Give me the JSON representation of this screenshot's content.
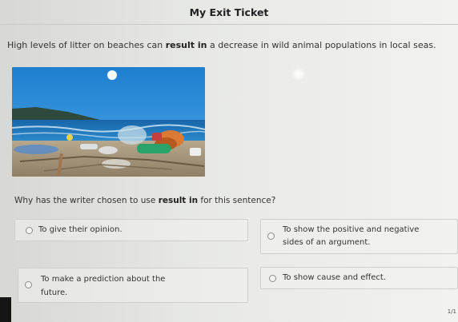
{
  "header": {
    "title": "My Exit Ticket"
  },
  "prompt": {
    "statement_before": "High levels of litter on beaches can ",
    "statement_keyword": "result in",
    "statement_after": " a decrease in wild animal populations in local seas."
  },
  "image": {
    "subject": "beach-litter-photo"
  },
  "question": {
    "before": "Why has the writer chosen to use ",
    "keyword": "result in",
    "after": " for this sentence?"
  },
  "options": [
    {
      "label": "To give their opinion.",
      "selected": false
    },
    {
      "label_line1": "To show the positive and negative",
      "label_line2": "sides of an argument.",
      "selected": false
    },
    {
      "label_line1": "To make a prediction about the",
      "label_line2": "future.",
      "selected": false
    },
    {
      "label": "To show cause and effect.",
      "selected": false
    }
  ],
  "footer": {
    "page_indicator": "1/1"
  }
}
